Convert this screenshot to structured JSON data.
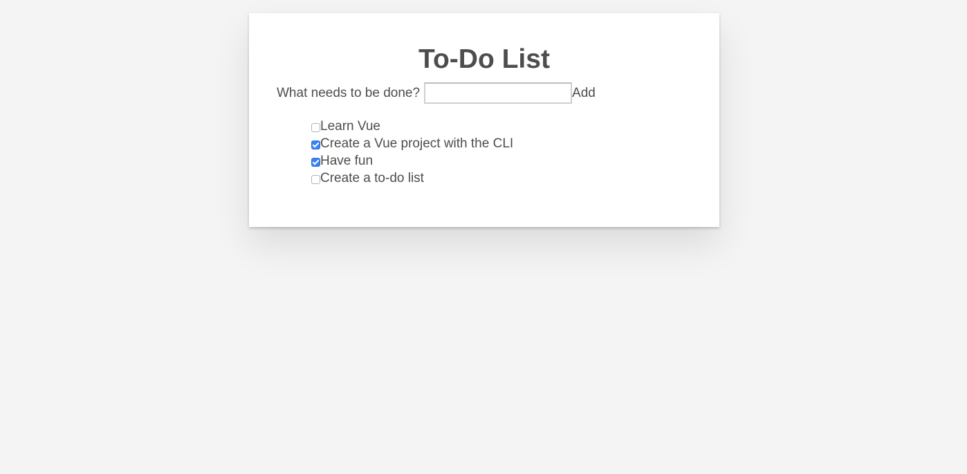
{
  "app": {
    "title": "To-Do List"
  },
  "form": {
    "label": "What needs to be done?",
    "input_value": "",
    "input_placeholder": "",
    "add_label": "Add"
  },
  "todos": [
    {
      "text": "Learn Vue",
      "done": false
    },
    {
      "text": "Create a Vue project with the CLI",
      "done": true
    },
    {
      "text": "Have fun",
      "done": true
    },
    {
      "text": "Create a to-do list",
      "done": false
    }
  ],
  "colors": {
    "background": "#f4f4f4",
    "card": "#ffffff",
    "text": "#4d4d4d",
    "checkbox_checked": "#3b82f6"
  }
}
